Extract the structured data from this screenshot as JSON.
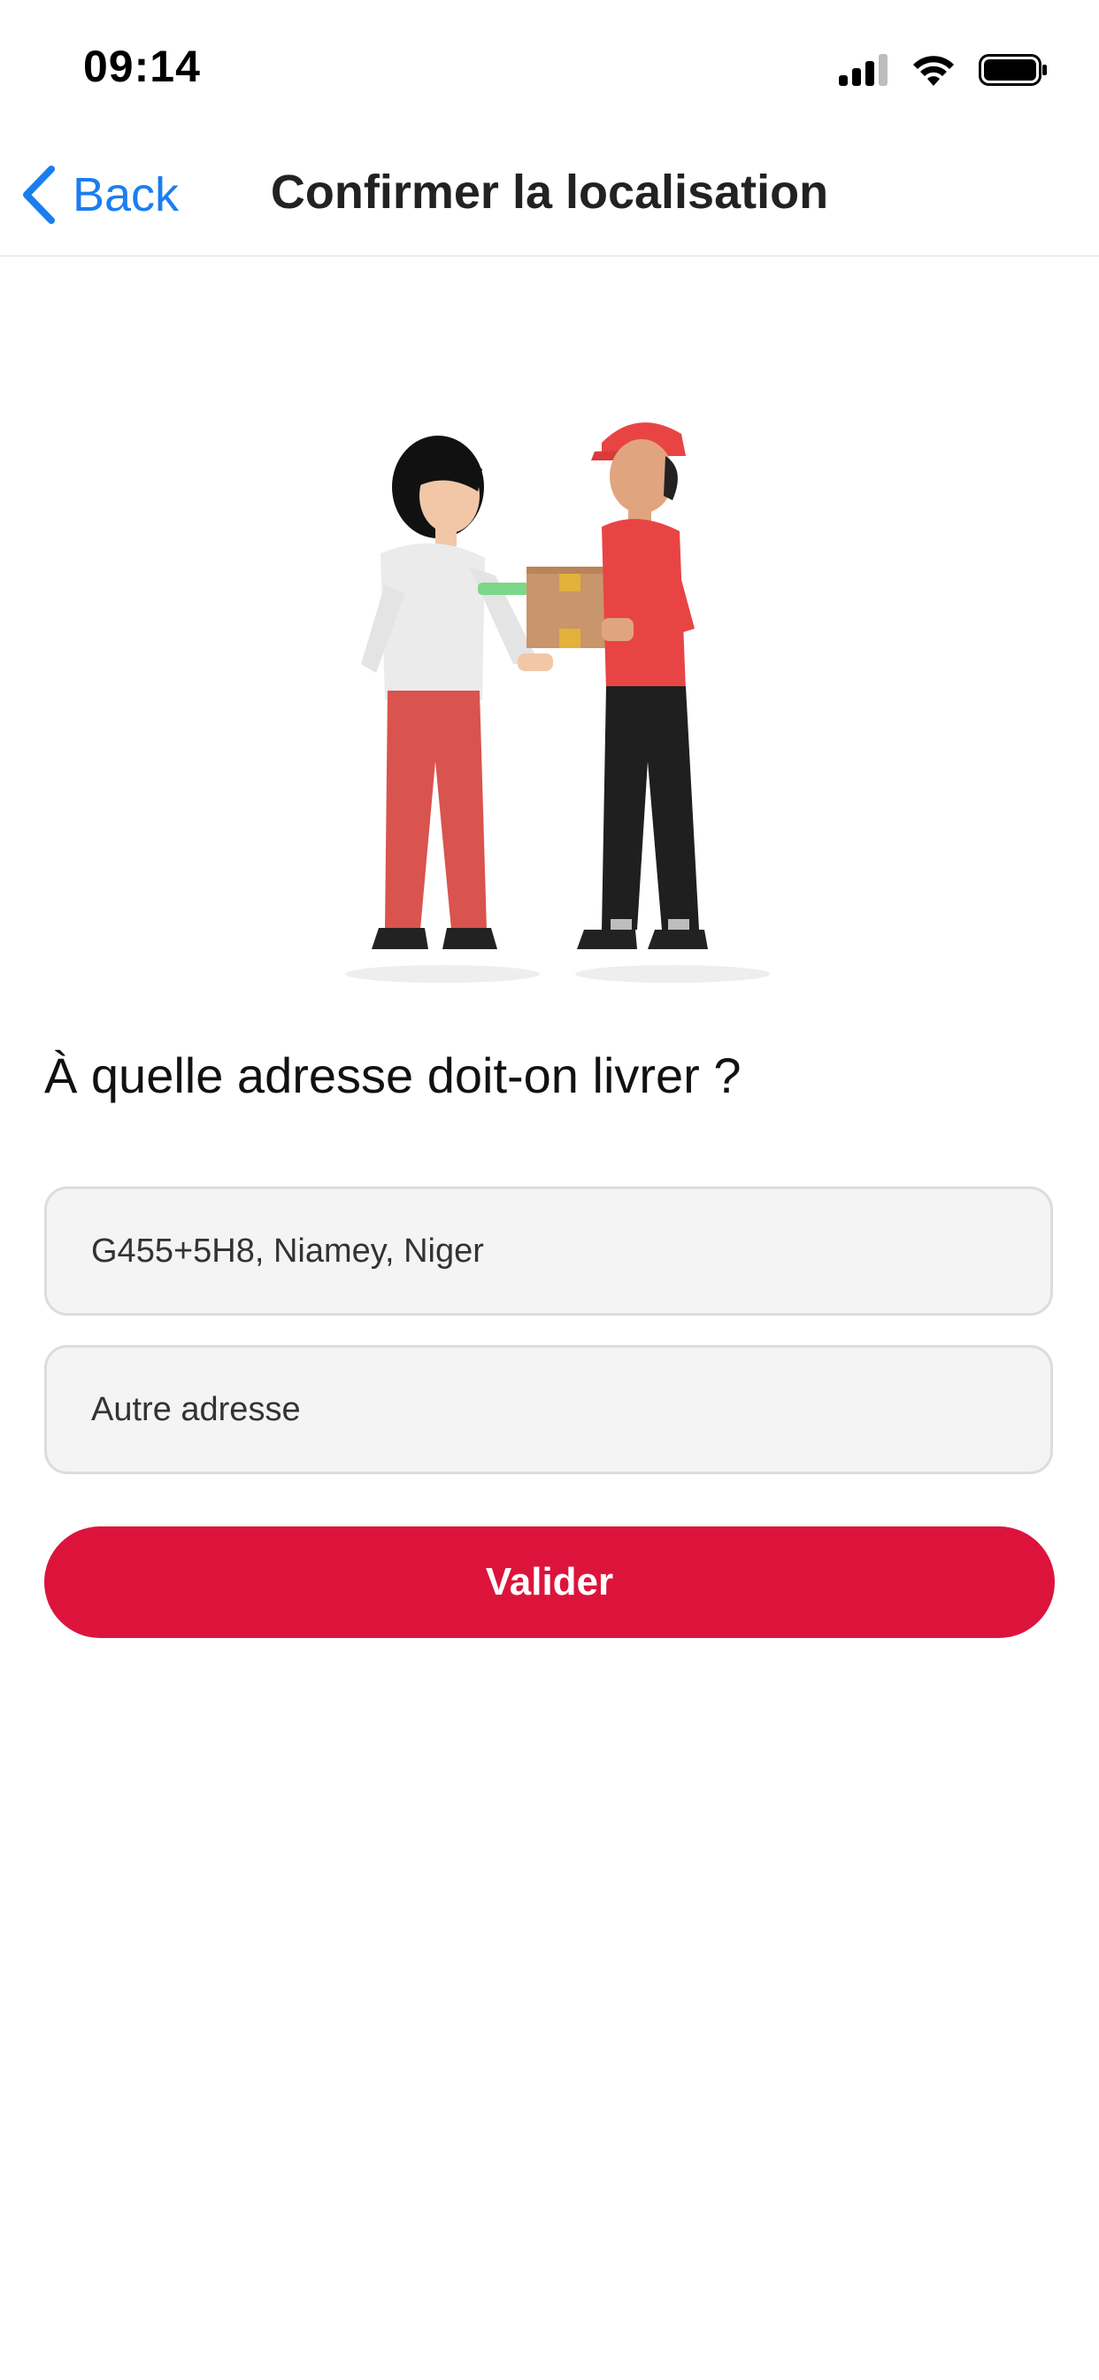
{
  "status_bar": {
    "time": "09:14",
    "icons": [
      "cellular-signal-icon",
      "wifi-icon",
      "battery-icon"
    ]
  },
  "nav": {
    "back_label": "Back",
    "title": "Confirmer la localisation"
  },
  "main": {
    "question": "À quelle adresse doit-on livrer ?",
    "address_options": [
      {
        "label": "G455+5H8, Niamey, Niger"
      },
      {
        "label": "Autre adresse"
      }
    ],
    "submit_label": "Valider"
  },
  "colors": {
    "accent": "#1a7ef0",
    "primary_button": "#dc143c",
    "field_background": "#f4f4f4"
  }
}
